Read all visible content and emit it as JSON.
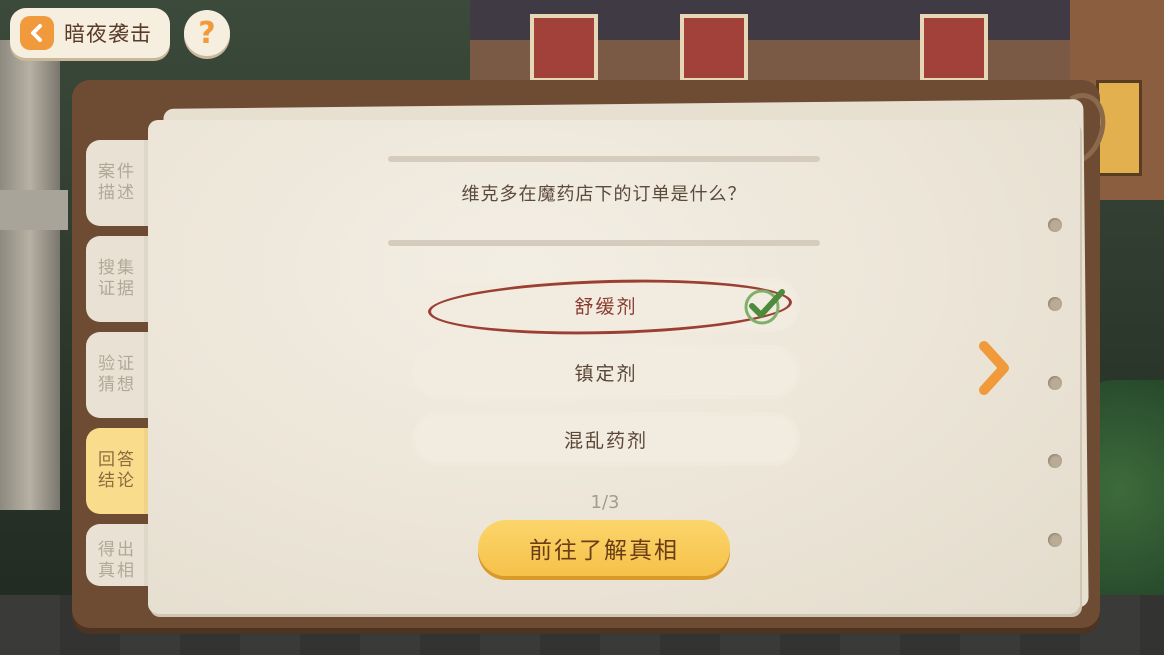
{
  "header": {
    "title": "暗夜袭击",
    "help_symbol": "?"
  },
  "side_tabs": [
    {
      "label": "案件描述",
      "active": false
    },
    {
      "label": "搜集证据",
      "active": false
    },
    {
      "label": "验证猜想",
      "active": false
    },
    {
      "label": "回答结论",
      "active": true
    },
    {
      "label": "得出真相",
      "active": false
    }
  ],
  "quiz": {
    "question": "维克多在魔药店下的订单是什么？",
    "options": [
      {
        "label": "舒缓剂",
        "selected": true
      },
      {
        "label": "镇定剂",
        "selected": false
      },
      {
        "label": "混乱药剂",
        "selected": false
      }
    ],
    "page_indicator": "1/3",
    "action_label": "前往了解真相"
  },
  "colors": {
    "accent": "#f09a3c",
    "button_yellow": "#f6c14a",
    "selection_red": "#9c3f33",
    "check_green": "#4f8a3c",
    "book_brown": "#6e4b33"
  },
  "icons": {
    "back": "back-arrow-icon",
    "help": "question-mark-icon",
    "next": "chevron-right-icon",
    "check": "checkmark-icon"
  }
}
